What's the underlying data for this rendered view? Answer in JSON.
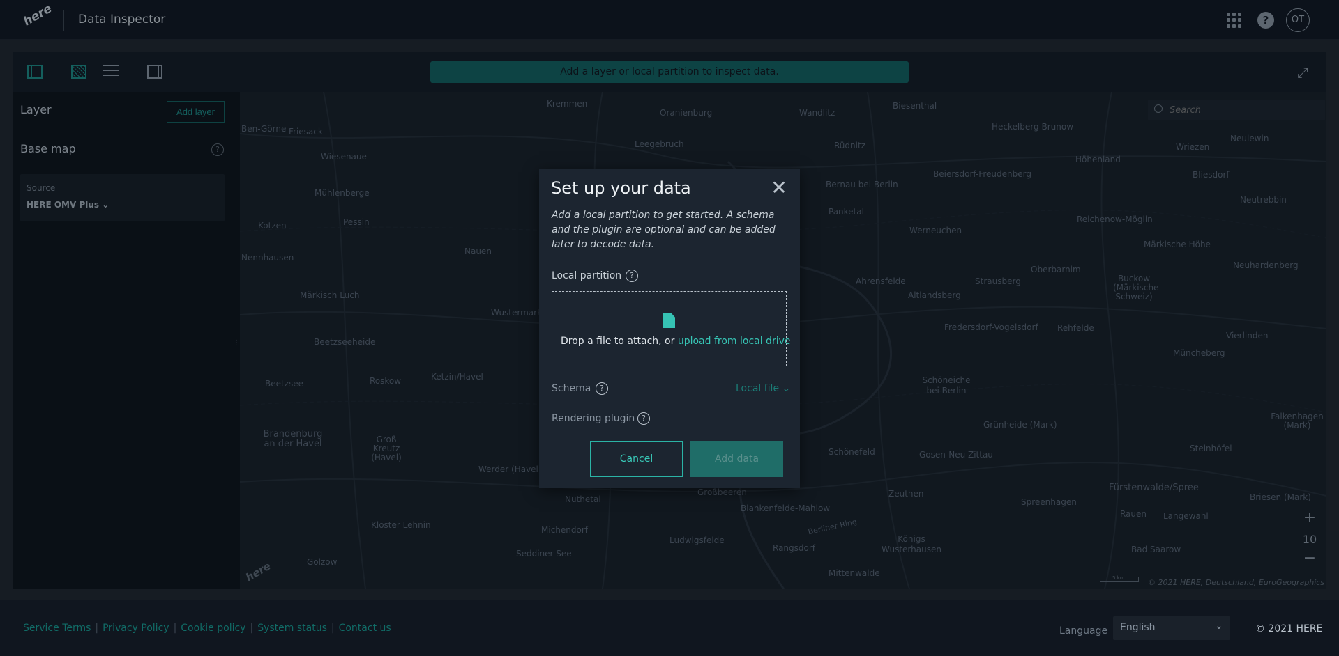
{
  "header": {
    "logo_text": "here",
    "app_title": "Data Inspector",
    "avatar_initials": "OT"
  },
  "toolbar": {
    "banner": "Add a layer or local partition to inspect data."
  },
  "left_panel": {
    "layer_title": "Layer",
    "add_layer_label": "Add layer",
    "basemap_title": "Base map",
    "source_label": "Source",
    "source_value": "HERE OMV Plus"
  },
  "map": {
    "search_placeholder": "Search",
    "zoom_level": "10",
    "copyright": "© 2021 HERE, Deutschland, EuroGeographics",
    "scale_label": "5 km",
    "logo_text": "here",
    "places": [
      "Kremmen",
      "Oranienburg",
      "Wandlitz",
      "Biesenthal",
      "Ben-Görne",
      "Friesack",
      "Leegebruch",
      "Rüdnitz",
      "Heckelberg-Brunow",
      "Neulewin",
      "Wiesenaue",
      "Höhenland",
      "Wriezen",
      "Mühlenberge",
      "Beiersdorf-Freudenberg",
      "Bliesdorf",
      "Bernau bei Berlin",
      "Neutrebbin",
      "Kotzen",
      "Pessin",
      "Panketal",
      "Werneuchen",
      "Reichenow-Möglin",
      "Nennhausen",
      "Nauen",
      "Märkische Höhe",
      "Oberbarnim",
      "Neuhardenberg",
      "Ahrensfelde",
      "Strausberg",
      "Buckow (Märkische Schweiz)",
      "Märkisch Luch",
      "Altlandsberg",
      "Wustermark",
      "Fredersdorf-Vogelsdorf",
      "Rehfelde",
      "Vierlinden",
      "Beetzseeheide",
      "Müncheberg",
      "Ketzin/Havel",
      "Schöneiche bei Berlin",
      "Beetzsee",
      "Roskow",
      "Grünheide (Mark)",
      "Falkenhagen (Mark)",
      "Brandenburg an der Havel",
      "Groß Kreutz (Havel)",
      "Werder (Havel)",
      "Schönefeld",
      "Gosen-Neu Zittau",
      "Steinhöfel",
      "Nuthetal",
      "Großbeeren",
      "Zeuthen",
      "Spreenhagen",
      "Fürstenwalde/Spree",
      "Blankenfelde-Mahlow",
      "Rauen",
      "Langewahl",
      "Briesen (Mark)",
      "Kloster Lehnin",
      "Michendorf",
      "Ludwigsfelde",
      "Rangsdorf",
      "Königs Wusterhausen",
      "Bad Saarow",
      "Seddiner See",
      "Golzow",
      "Mittenwalde",
      "Berliner Ring"
    ]
  },
  "modal": {
    "title": "Set up your data",
    "close_glyph": "✕",
    "description": "Add a local partition to get started. A schema and the plugin are optional and can be added later to decode data.",
    "local_partition_label": "Local partition",
    "drop_text": "Drop a file to attach, or ",
    "drop_link": "upload from local drive",
    "schema_label": "Schema",
    "schema_value": "Local file",
    "rendering_plugin_label": "Rendering plugin",
    "cancel_label": "Cancel",
    "add_data_label": "Add data",
    "help_glyph": "?"
  },
  "footer": {
    "links": [
      "Service Terms",
      "Privacy Policy",
      "Cookie policy",
      "System status",
      "Contact us"
    ],
    "language_label": "Language",
    "language_value": "English",
    "copyright": "© 2021 HERE"
  },
  "colors": {
    "accent": "#36c3b4",
    "banner": "#10605e",
    "background": "#0f151f"
  }
}
